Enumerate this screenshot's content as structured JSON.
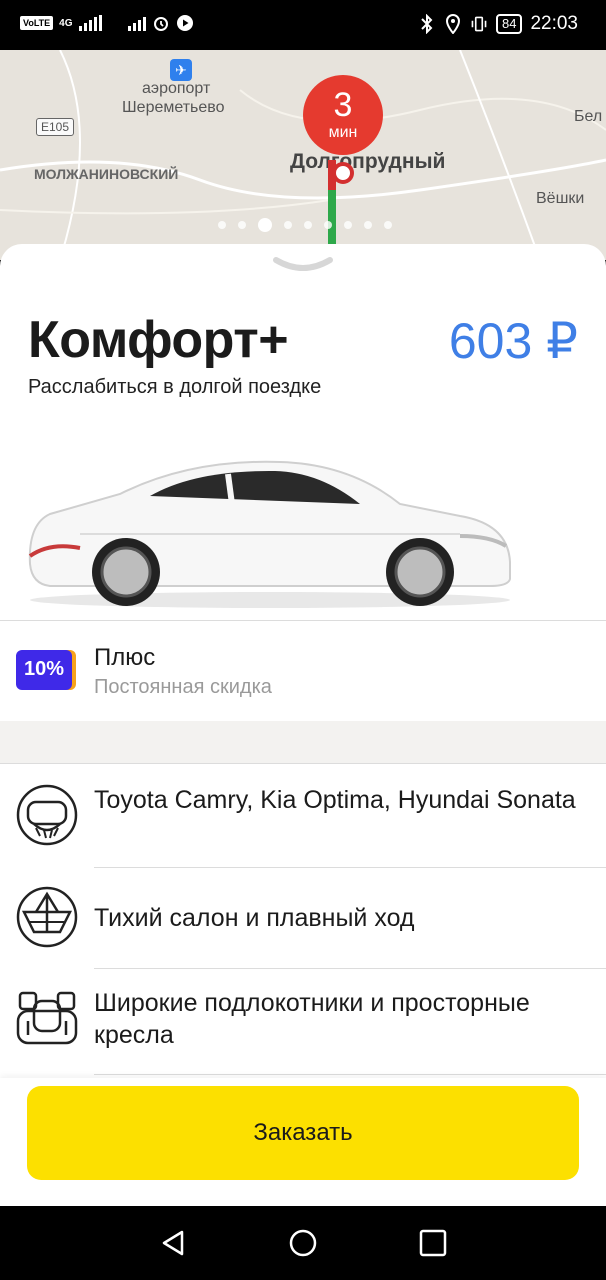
{
  "status_bar": {
    "volte": "VoLTE",
    "network": "4G",
    "battery": "84",
    "time": "22:03"
  },
  "map": {
    "airport_label_1": "аэропорт",
    "airport_label_2": "Шереметьево",
    "road_tag": "E105",
    "district": "МОЛЖАНИНОВСКИЙ",
    "town": "Долгопрудный",
    "village": "Вёшки",
    "edge_label": "Бел",
    "eta_value": "3",
    "eta_unit": "мин",
    "page_count": 9,
    "active_page": 3
  },
  "tariff": {
    "title": "Комфорт+",
    "price": "603 ₽",
    "subtitle": "Расслабиться в долгой поездке"
  },
  "plus": {
    "badge": "10%",
    "title": "Плюс",
    "subtitle": "Постоянная скидка"
  },
  "features": [
    {
      "text": "Toyota Camry, Kia Optima, Hyundai Sonata",
      "icon": "steering-wheel-icon"
    },
    {
      "text": "Тихий салон и плавный ход",
      "icon": "paper-boat-icon"
    },
    {
      "text": "Широкие подлокотники и просторные кресла",
      "icon": "seats-icon"
    }
  ],
  "order_button": "Заказать",
  "colors": {
    "accent_yellow": "#fce000",
    "price_blue": "#3f7fe6",
    "eta_red": "#e53a2f",
    "plus_purple": "#3f29e8"
  }
}
